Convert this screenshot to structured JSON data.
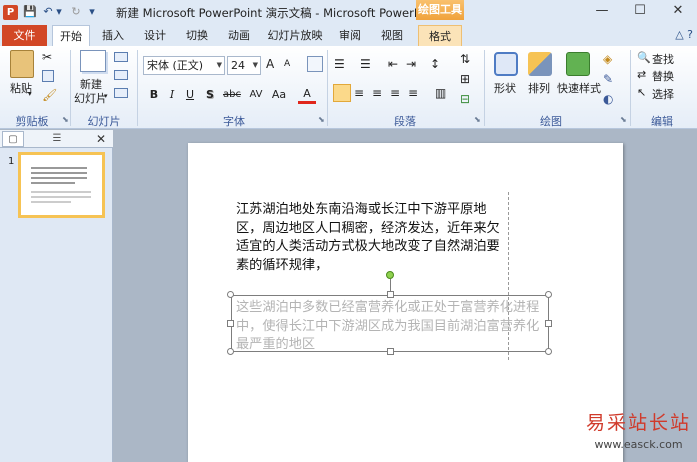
{
  "titlebar": {
    "app_icon": "P",
    "title": "新建 Microsoft PowerPoint 演示文稿 - Microsoft PowerPoint",
    "context_header": "绘图工具",
    "qat": {
      "save": "💾",
      "undo": "↶",
      "undo_drop": "▾",
      "redo": "↻",
      "customize": "▾"
    },
    "minimize": "—",
    "maximize": "☐",
    "close": "✕"
  },
  "tabs": {
    "file": "文件",
    "items": [
      "开始",
      "插入",
      "设计",
      "切换",
      "动画",
      "幻灯片放映",
      "审阅",
      "视图",
      "格式"
    ],
    "help": "△ ?"
  },
  "ribbon": {
    "clipboard": {
      "label": "剪贴板",
      "paste": "粘贴"
    },
    "slides": {
      "label": "幻灯片",
      "new_slide_1": "新建",
      "new_slide_2": "幻灯片"
    },
    "font": {
      "label": "字体",
      "font_name": "宋体 (正文)",
      "font_size": "24",
      "bold": "B",
      "italic": "I",
      "underline": "U",
      "shadow": "S",
      "strike": "abc",
      "spacing": "AV",
      "case": "Aa",
      "color": "A",
      "grow": "A",
      "shrink": "A"
    },
    "paragraph": {
      "label": "段落"
    },
    "drawing": {
      "label": "绘图",
      "shape": "形状",
      "arrange": "排列",
      "quick_styles": "快速样式"
    },
    "editing": {
      "label": "编辑",
      "find": "查找",
      "replace": "替换",
      "select": "选择"
    }
  },
  "leftpanel": {
    "slide_number": "1",
    "close": "✕"
  },
  "slide": {
    "paragraph1": "江苏湖泊地处东南沿海或长江中下游平原地区，周边地区人口稠密，经济发达，近年来欠适宜的人类活动方式极大地改变了自然湖泊要素的循环规律，",
    "paragraph2": "这些湖泊中多数已经富营养化或正处于富营养化进程中，使得长江中下游湖区成为我国目前湖泊富营养化最严重的地区"
  },
  "watermark": {
    "title": "易采站长站",
    "url": "www.easck.com"
  }
}
